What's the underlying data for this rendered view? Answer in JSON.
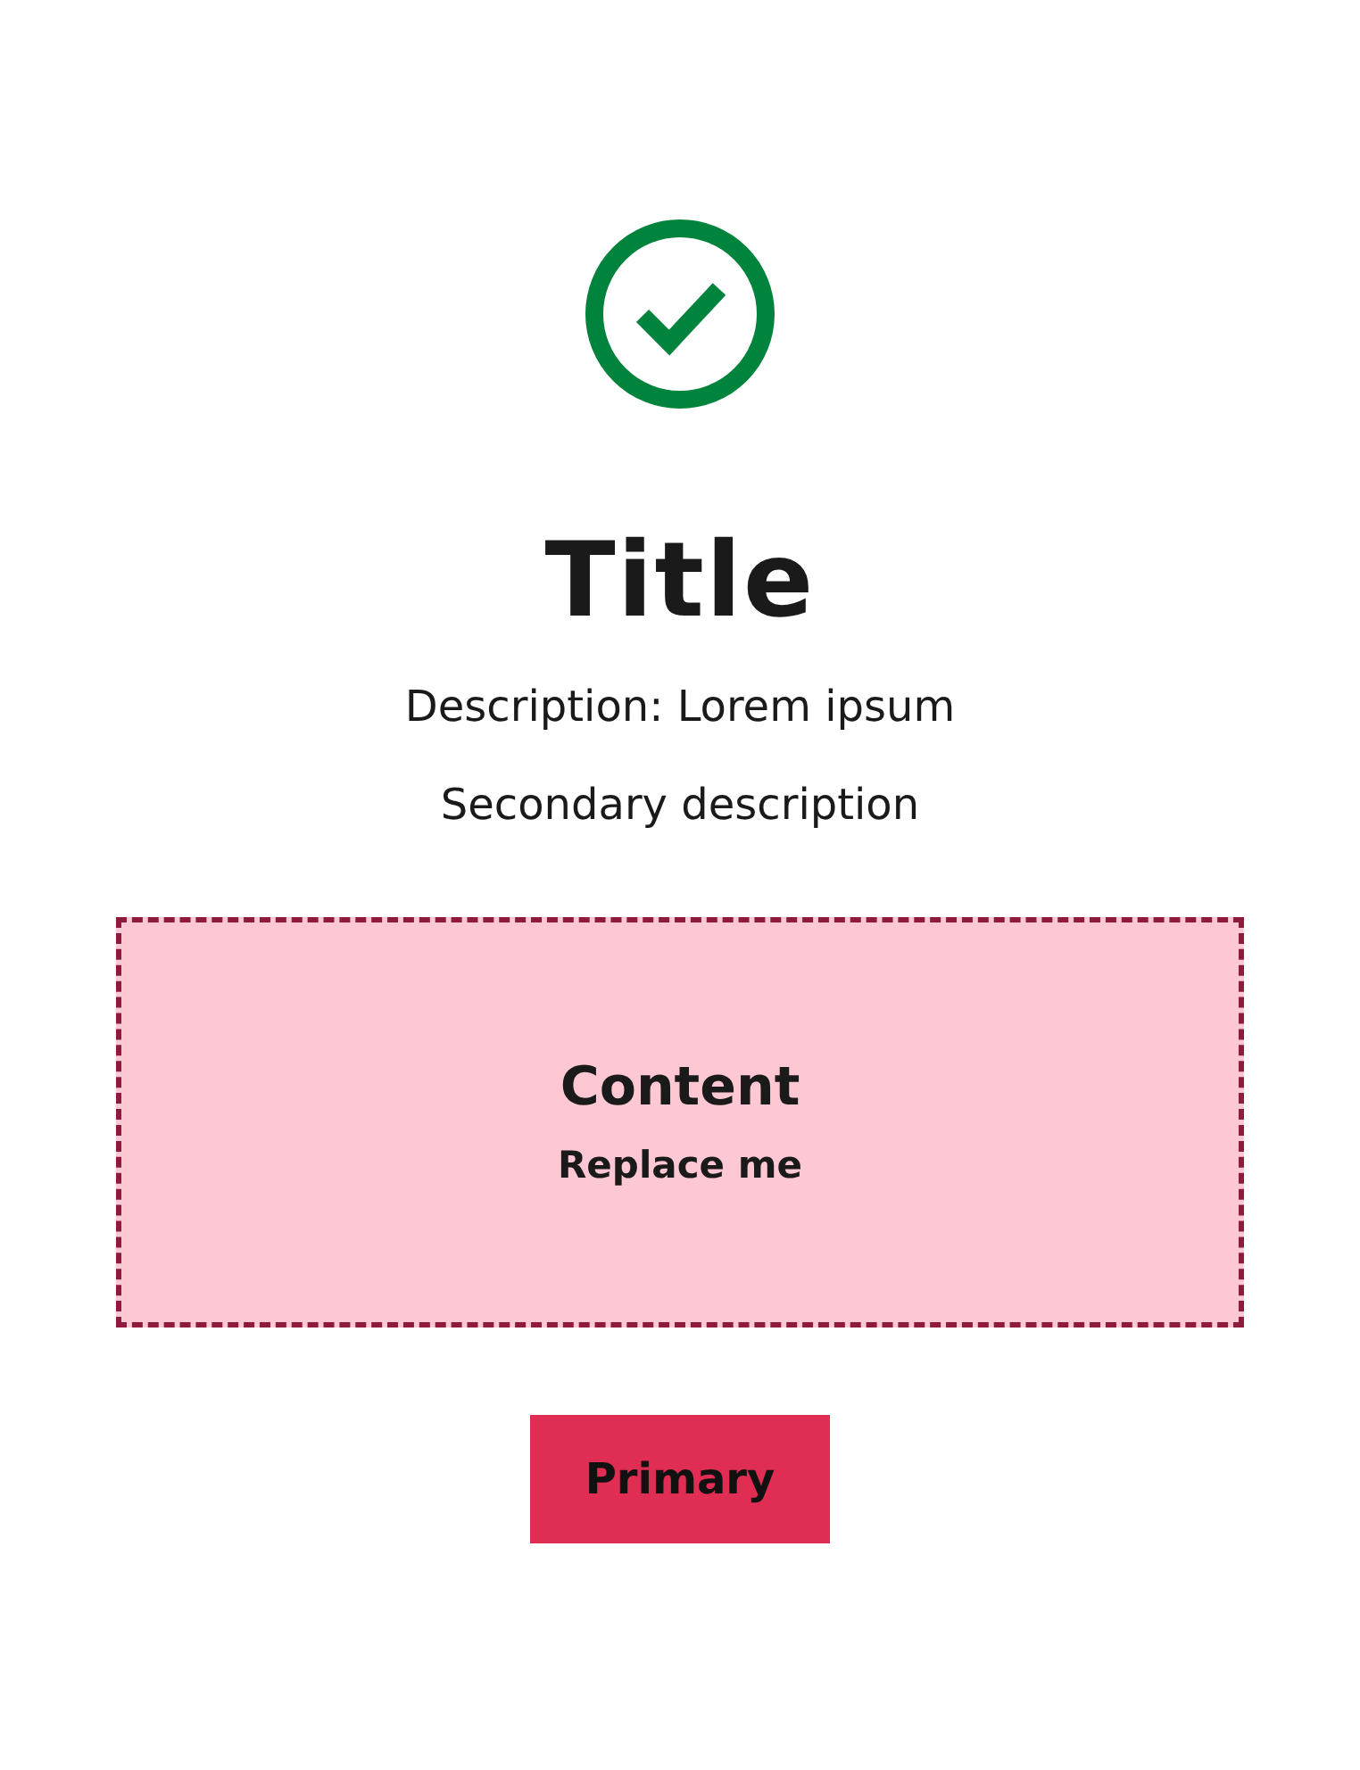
{
  "status": {
    "kind": "success"
  },
  "title": "Title",
  "description": "Description: Lorem ipsum",
  "secondary_description": "Secondary description",
  "content": {
    "title": "Content",
    "text": "Replace me"
  },
  "buttons": [
    {
      "label": "Primary",
      "kind": "primary"
    }
  ]
}
